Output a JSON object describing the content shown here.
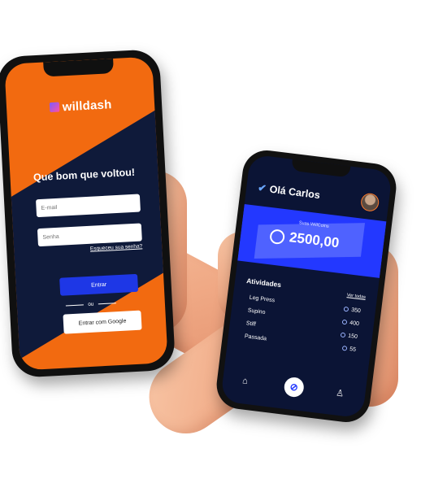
{
  "left_phone": {
    "brand": "willdash",
    "welcome": "Que bom que voltou!",
    "email_placeholder": "E-mail",
    "password_placeholder": "Senha",
    "forgot": "Esqueceu sua senha?",
    "login_button": "Entrar",
    "or": "ou",
    "google_button": "Entrar com Google"
  },
  "right_phone": {
    "greeting": "Olá Carlos",
    "card_label": "Suas WillCoins",
    "balance": "2500,00",
    "activities_title": "Atividades",
    "see_all": "Ver todas",
    "activities": [
      {
        "name": "Leg Press",
        "points": "350"
      },
      {
        "name": "Supino",
        "points": "400"
      },
      {
        "name": "Stiff",
        "points": "150"
      },
      {
        "name": "Passada",
        "points": "55"
      }
    ],
    "tabs": [
      "home-icon",
      "willcoin-icon",
      "profile-icon"
    ]
  },
  "colors": {
    "orange": "#f26a10",
    "navy": "#0b1435",
    "blue": "#2338ff"
  }
}
